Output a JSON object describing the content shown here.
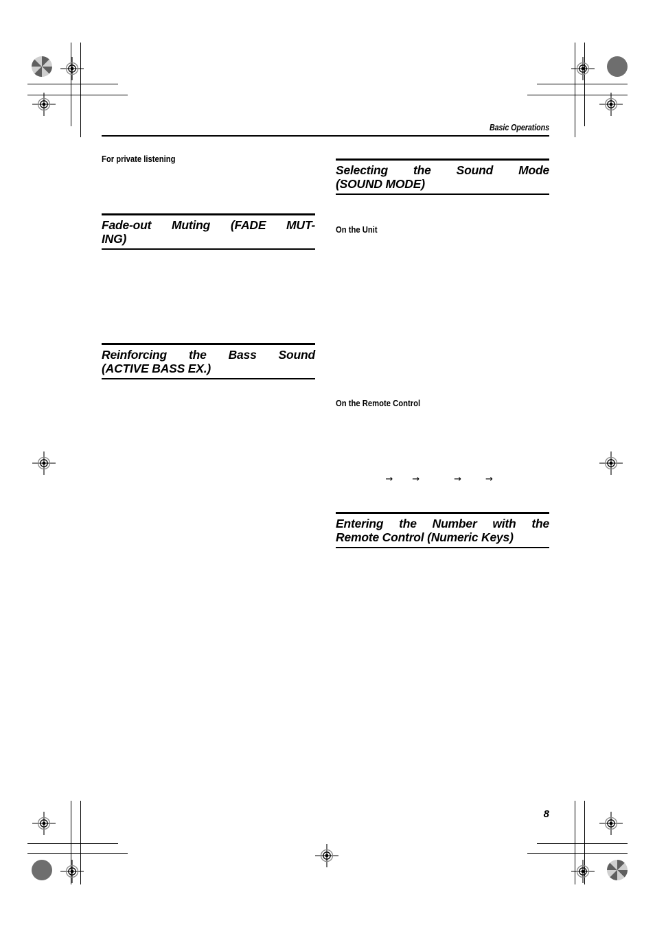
{
  "page": {
    "running_head": "Basic Operations",
    "page_number": "8"
  },
  "left_column": {
    "sub_head_1": "For private listening",
    "heading_1": {
      "line1": "Fade-out Muting (FADE MUT-",
      "line2": "ING)"
    },
    "heading_2": {
      "line1": "Reinforcing the Bass Sound",
      "line2": "(ACTIVE BASS EX.)"
    }
  },
  "right_column": {
    "heading_1": {
      "line1": "Selecting the Sound Mode",
      "line2": "(SOUND MODE)"
    },
    "sub_head_1": "On the Unit",
    "sub_head_2": "On the Remote Control",
    "sequence_arrows": [
      "→",
      "→",
      "→",
      "→"
    ],
    "heading_2": {
      "line1": "Entering the Number with the",
      "line2": "Remote Control (Numeric Keys)"
    }
  },
  "printers_marks": {
    "registration_target_name": "registration-target",
    "density_patch_name": "density-patch",
    "trim_mark_name": "trim-mark",
    "colors": {
      "ink": "#000000",
      "patch_gray": "#6e6e6e",
      "patch_screen": "#8a8a8a"
    }
  }
}
